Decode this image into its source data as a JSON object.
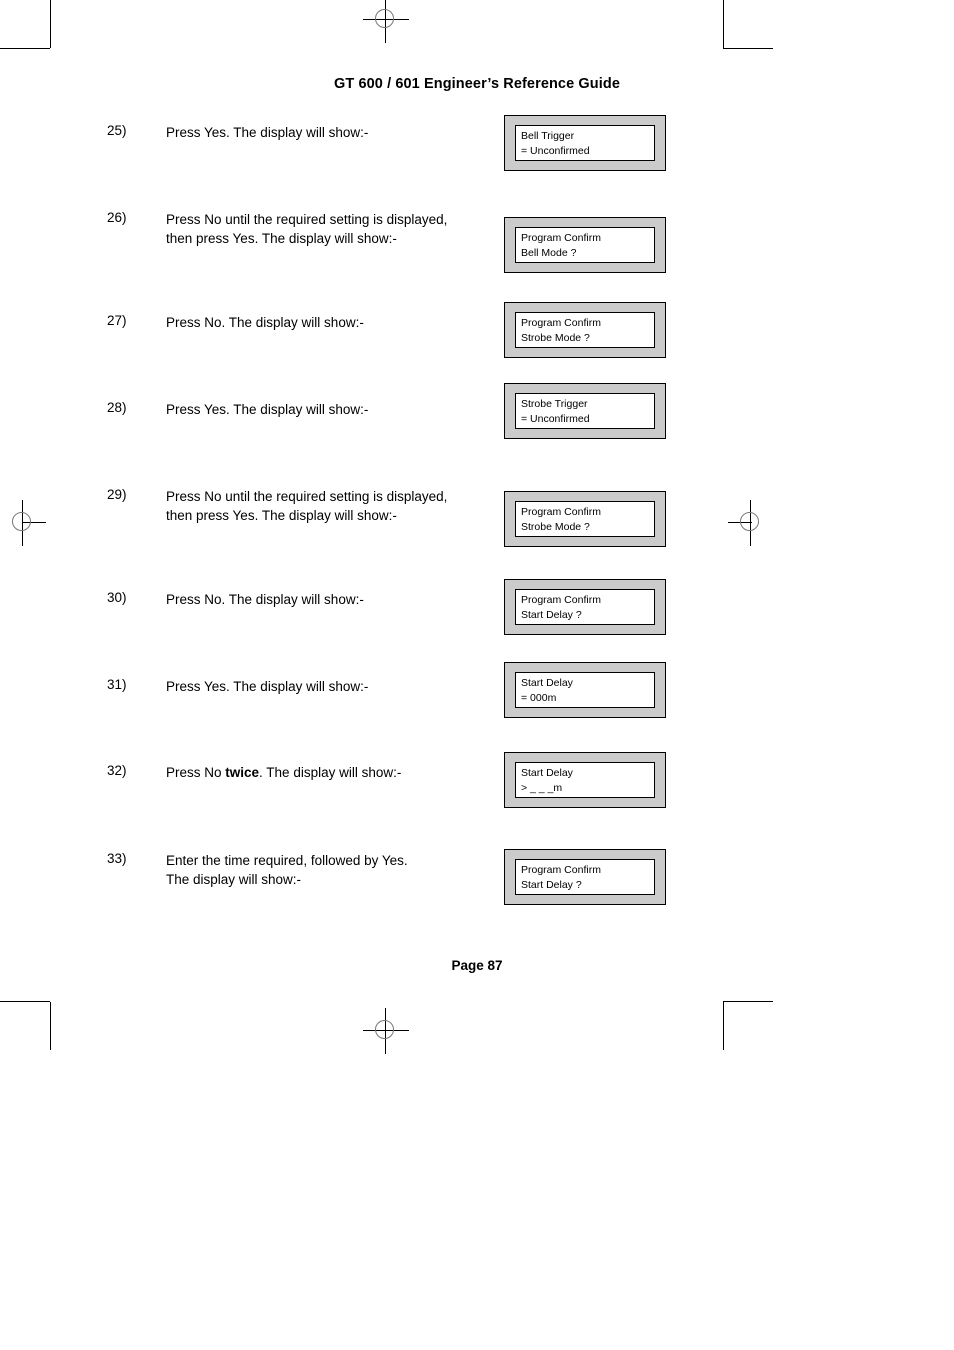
{
  "header": {
    "title": "GT 600 / 601 Engineer’s Reference Guide"
  },
  "footer": {
    "page_label": "Page  87"
  },
  "steps": [
    {
      "number": "25)",
      "lines": [
        "Press Yes. The display will show:-"
      ],
      "display": {
        "line1": "Bell Trigger",
        "line2": "= Unconfirmed"
      }
    },
    {
      "number": "26)",
      "lines": [
        "Press No until the required setting is displayed,",
        "then press Yes. The display will show:-"
      ],
      "display": {
        "line1": "Program Confirm",
        "line2": "Bell Mode ?"
      }
    },
    {
      "number": "27)",
      "lines": [
        "Press No. The display will show:-"
      ],
      "display": {
        "line1": "Program Confirm",
        "line2": "Strobe Mode ?"
      }
    },
    {
      "number": "28)",
      "lines": [
        "Press Yes. The display will show:-"
      ],
      "display": {
        "line1": "Strobe Trigger",
        "line2": "= Unconfirmed"
      }
    },
    {
      "number": "29)",
      "lines": [
        "Press No until the required setting is displayed,",
        "then press Yes. The display will show:-"
      ],
      "display": {
        "line1": "Program Confirm",
        "line2": "Strobe Mode ?"
      }
    },
    {
      "number": "30)",
      "lines": [
        "Press No. The display will show:-"
      ],
      "display": {
        "line1": "Program Confirm",
        "line2": "Start Delay ?"
      }
    },
    {
      "number": "31)",
      "lines": [
        "Press Yes. The display will show:-"
      ],
      "display": {
        "line1": "Start Delay",
        "line2": "= 000m"
      }
    },
    {
      "number": "32)",
      "lines": [
        "Press No twice. The display will show:-"
      ],
      "emphasis": "twice",
      "display": {
        "line1": "Start Delay",
        "line2": "> _ _ _m"
      }
    },
    {
      "number": "33)",
      "lines": [
        "Enter the time required, followed by Yes.",
        "The display will show:-"
      ],
      "display": {
        "line1": "Program Confirm",
        "line2": "Start Delay ?"
      }
    }
  ]
}
